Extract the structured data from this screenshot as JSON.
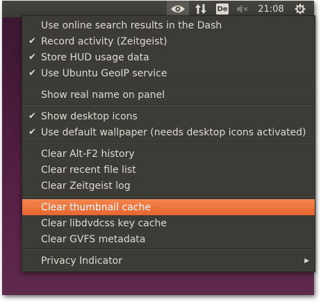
{
  "topbar": {
    "icons": {
      "eye": "eye-icon",
      "network": "network-updown-icon",
      "volume": "volume-muted-icon",
      "session": "gear-power-icon"
    },
    "keyboard_layout": "De",
    "clock": "21:08"
  },
  "menu": {
    "items": [
      {
        "label": "Use online search results in the Dash",
        "checked": false
      },
      {
        "label": "Record activity (Zeitgeist)",
        "checked": true
      },
      {
        "label": "Store HUD usage data",
        "checked": true
      },
      {
        "label": "Use Ubuntu GeoIP service",
        "checked": true
      },
      {
        "label": "Show real name on panel",
        "checked": false
      },
      {
        "label": "Show desktop icons",
        "checked": true
      },
      {
        "label": "Use default wallpaper (needs desktop icons activated)",
        "checked": true
      },
      {
        "label": "Clear Alt-F2 history"
      },
      {
        "label": "Clear recent file list"
      },
      {
        "label": "Clear Zeitgeist log"
      },
      {
        "label": "Clear thumbnail cache",
        "highlighted": true
      },
      {
        "label": "Clear libdvdcss key cache"
      },
      {
        "label": "Clear GVFS metadata"
      },
      {
        "label": "Privacy Indicator",
        "submenu": true
      }
    ],
    "check_glyph": "✔",
    "submenu_glyph": "▶"
  },
  "colors": {
    "panel": "#3c3b37",
    "menu_bg": "#3c3b37",
    "menu_text": "#dfdbd2",
    "highlight": "#e6672f",
    "desktop": "#4a1c3b"
  }
}
